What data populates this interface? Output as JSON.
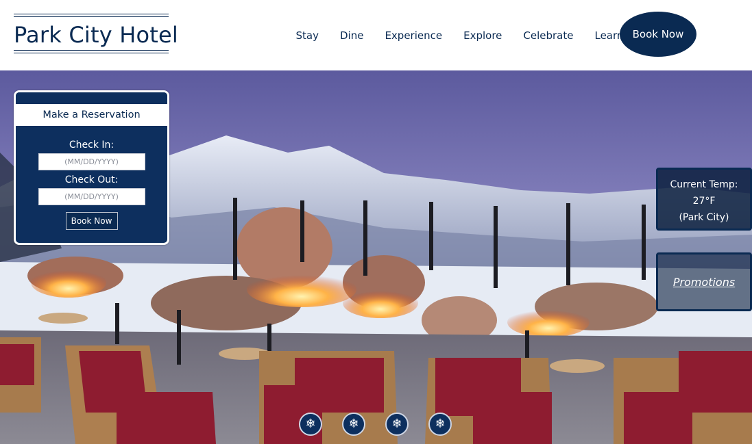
{
  "brand": {
    "name": "Park City Hotel",
    "primary_color": "#0a2a52"
  },
  "nav": {
    "items": [
      {
        "label": "Stay"
      },
      {
        "label": "Dine"
      },
      {
        "label": "Experience"
      },
      {
        "label": "Explore"
      },
      {
        "label": "Celebrate"
      },
      {
        "label": "Learn"
      }
    ],
    "cta_label": "Book Now"
  },
  "hero": {
    "image": "mountain-fire-pit-patio-photo"
  },
  "reservation": {
    "title": "Make a Reservation",
    "check_in_label": "Check In:",
    "check_in_placeholder": "(MM/DD/YYYY)",
    "check_out_label": "Check Out:",
    "check_out_placeholder": "(MM/DD/YYYY)",
    "button_label": "Book Now"
  },
  "weather": {
    "label": "Current Temp:",
    "value": "27°F",
    "location": "(Park City)"
  },
  "promotions": {
    "label": "Promotions"
  },
  "slider": {
    "icon": "snowflake-icon",
    "glyph": "❄",
    "dots": [
      {
        "glyph": "❄"
      },
      {
        "glyph": "❄"
      },
      {
        "glyph": "❄"
      },
      {
        "glyph": "❄"
      }
    ]
  }
}
